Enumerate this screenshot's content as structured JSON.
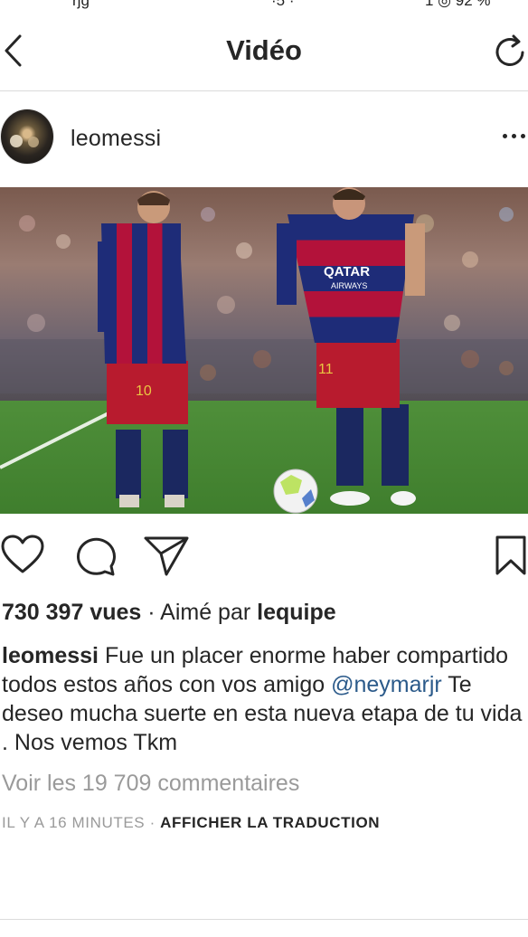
{
  "navbar": {
    "title": "Vidéo"
  },
  "post": {
    "username": "leomessi",
    "views": "730 397 vues",
    "liked_by_prefix": "Aimé par",
    "liked_by_user": "lequipe",
    "caption_user": "leomessi",
    "caption_part1": "Fue un placer enorme haber compartido todos estos años con vos amigo",
    "caption_mention": "@neymarjr",
    "caption_part2": "Te deseo mucha suerte en esta nueva etapa de tu vida . Nos vemos  Tkm",
    "comments_link": "Voir les 19 709 commentaires",
    "timestamp": "IL Y A 16 MINUTES",
    "translate_label": "AFFICHER LA TRADUCTION"
  },
  "media_text": {
    "shirt_sponsor": "QATAR",
    "shirt_sponsor_sub": "AIRWAYS",
    "messi_number": "10",
    "neymar_number": "11"
  },
  "icons": [
    "back-icon",
    "refresh-icon",
    "more-icon",
    "heart-icon",
    "comment-icon",
    "share-icon",
    "bookmark-icon"
  ],
  "colors": {
    "text": "#262626",
    "muted": "#9a9a9a",
    "mention": "#2b5a8a",
    "divider": "#dbdbdb"
  }
}
